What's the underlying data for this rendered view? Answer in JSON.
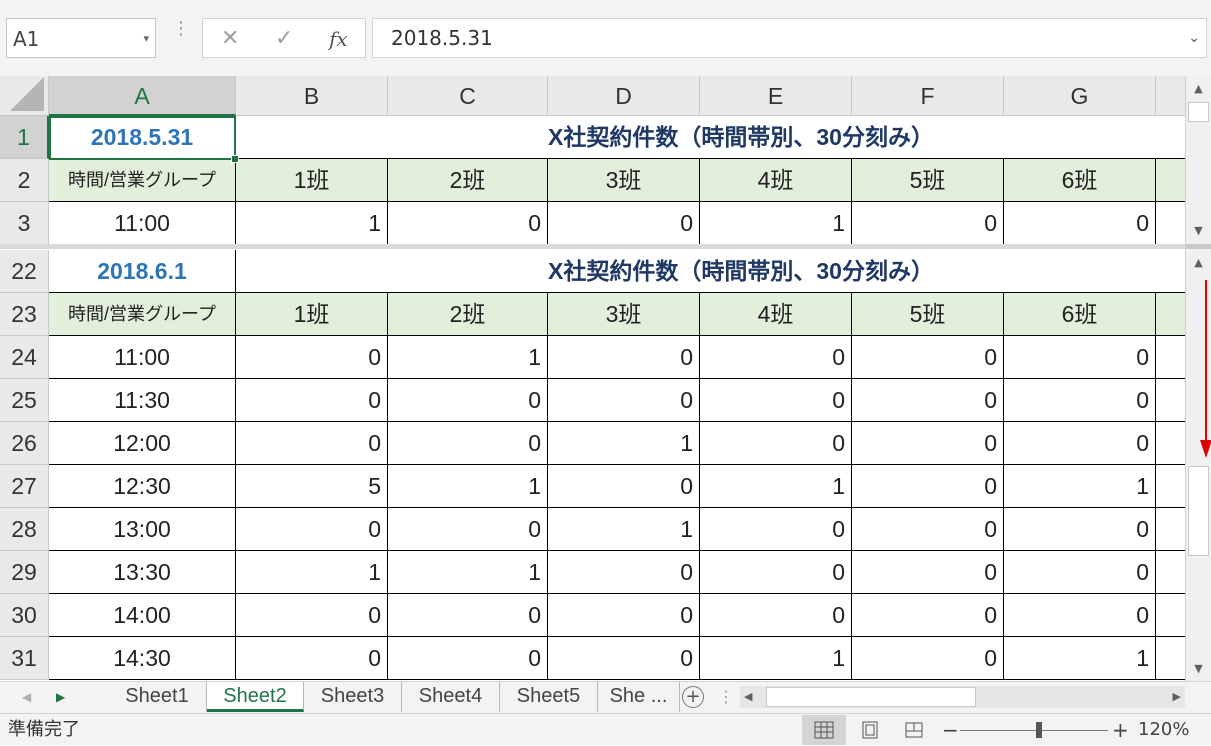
{
  "formula_bar": {
    "name_box": "A1",
    "cancel_glyph": "✕",
    "enter_glyph": "✓",
    "fx_label": "fx",
    "value": "2018.5.31"
  },
  "columns": [
    "A",
    "B",
    "C",
    "D",
    "E",
    "F",
    "G"
  ],
  "top_pane": {
    "rows": [
      {
        "num": "1",
        "type": "title",
        "date": "2018.5.31",
        "title": "X社契約件数（時間帯別、30分刻み）"
      },
      {
        "num": "2",
        "type": "header",
        "label": "時間/営業グループ",
        "groups": [
          "1班",
          "2班",
          "3班",
          "4班",
          "5班",
          "6班"
        ]
      },
      {
        "num": "3",
        "type": "data",
        "time": "11:00",
        "values": [
          "1",
          "0",
          "0",
          "1",
          "0",
          "0"
        ]
      }
    ]
  },
  "bottom_pane": {
    "rows": [
      {
        "num": "22",
        "type": "title",
        "date": "2018.6.1",
        "title": "X社契約件数（時間帯別、30分刻み）"
      },
      {
        "num": "23",
        "type": "header",
        "label": "時間/営業グループ",
        "groups": [
          "1班",
          "2班",
          "3班",
          "4班",
          "5班",
          "6班"
        ]
      },
      {
        "num": "24",
        "type": "data",
        "time": "11:00",
        "values": [
          "0",
          "1",
          "0",
          "0",
          "0",
          "0"
        ]
      },
      {
        "num": "25",
        "type": "data",
        "time": "11:30",
        "values": [
          "0",
          "0",
          "0",
          "0",
          "0",
          "0"
        ]
      },
      {
        "num": "26",
        "type": "data",
        "time": "12:00",
        "values": [
          "0",
          "0",
          "1",
          "0",
          "0",
          "0"
        ]
      },
      {
        "num": "27",
        "type": "data",
        "time": "12:30",
        "values": [
          "5",
          "1",
          "0",
          "1",
          "0",
          "1"
        ]
      },
      {
        "num": "28",
        "type": "data",
        "time": "13:00",
        "values": [
          "0",
          "0",
          "1",
          "0",
          "0",
          "0"
        ]
      },
      {
        "num": "29",
        "type": "data",
        "time": "13:30",
        "values": [
          "1",
          "1",
          "0",
          "0",
          "0",
          "0"
        ]
      },
      {
        "num": "30",
        "type": "data",
        "time": "14:00",
        "values": [
          "0",
          "0",
          "0",
          "0",
          "0",
          "0"
        ]
      },
      {
        "num": "31",
        "type": "data",
        "time": "14:30",
        "values": [
          "0",
          "0",
          "0",
          "1",
          "0",
          "1"
        ]
      }
    ]
  },
  "sheet_tabs": [
    {
      "label": "Sheet1",
      "active": false
    },
    {
      "label": "Sheet2",
      "active": true
    },
    {
      "label": "Sheet3",
      "active": false
    },
    {
      "label": "Sheet4",
      "active": false
    },
    {
      "label": "Sheet5",
      "active": false
    },
    {
      "label": "She ...",
      "active": false
    }
  ],
  "add_sheet_glyph": "+",
  "status_bar": {
    "ready": "準備完了",
    "zoom_minus": "−",
    "zoom_plus": "+",
    "zoom_level": "120%"
  },
  "colors": {
    "excel_green": "#217346",
    "date_blue": "#2e75b6",
    "title_navy": "#1f3864",
    "header_fill": "#e2efda",
    "annotation_red": "#e00000"
  }
}
